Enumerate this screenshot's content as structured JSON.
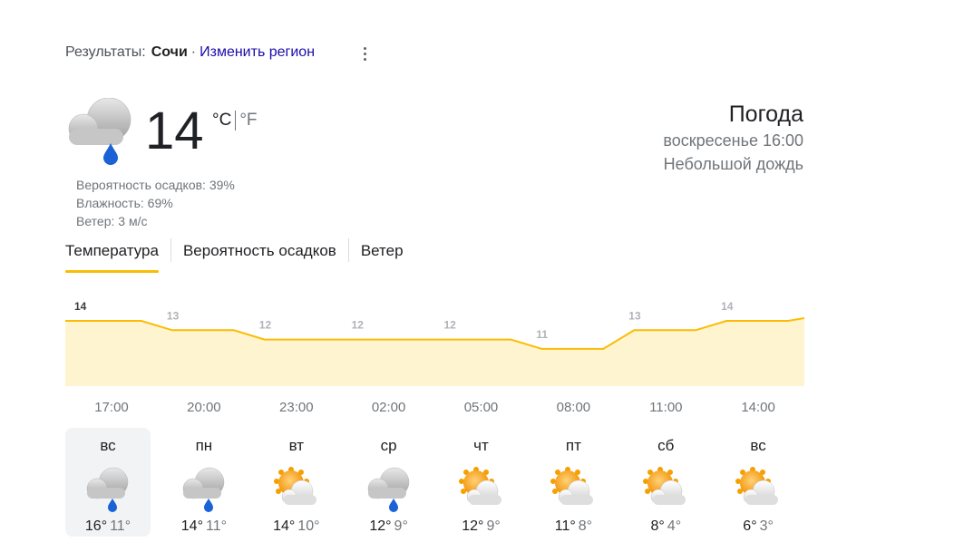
{
  "results": {
    "label": "Результаты:",
    "city": "Сочи",
    "separator": "·",
    "change_region": "Изменить регион"
  },
  "current": {
    "temperature": "14",
    "unit_c": "°C",
    "unit_f": "°F",
    "icon": "rain-cloud-icon",
    "precipitation": "Вероятность осадков: 39%",
    "humidity": "Влажность: 69%",
    "wind": "Ветер: 3 м/с"
  },
  "summary": {
    "title": "Погода",
    "datetime": "воскресенье 16:00",
    "condition": "Небольшой дождь"
  },
  "tabs": [
    {
      "label": "Температура",
      "active": true
    },
    {
      "label": "Вероятность осадков",
      "active": false
    },
    {
      "label": "Ветер",
      "active": false
    }
  ],
  "chart_data": {
    "type": "area",
    "x": [
      "17:00",
      "20:00",
      "23:00",
      "02:00",
      "05:00",
      "08:00",
      "11:00",
      "14:00"
    ],
    "values": [
      14,
      13,
      12,
      12,
      12,
      11,
      13,
      14
    ],
    "labels": [
      "14",
      "13",
      "12",
      "12",
      "12",
      "11",
      "13",
      "14"
    ],
    "ylim": [
      0,
      15
    ],
    "colors": {
      "line": "#fbbc04",
      "fill": "#fef5d0"
    }
  },
  "days": [
    {
      "name": "вс",
      "high": "16°",
      "low": "11°",
      "icon": "rain-cloud-icon",
      "selected": true
    },
    {
      "name": "пн",
      "high": "14°",
      "low": "11°",
      "icon": "rain-cloud-icon",
      "selected": false
    },
    {
      "name": "вт",
      "high": "14°",
      "low": "10°",
      "icon": "sun-behind-cloud-icon",
      "selected": false
    },
    {
      "name": "ср",
      "high": "12°",
      "low": "9°",
      "icon": "rain-cloud-icon",
      "selected": false
    },
    {
      "name": "чт",
      "high": "12°",
      "low": "9°",
      "icon": "sun-behind-cloud-icon",
      "selected": false
    },
    {
      "name": "пт",
      "high": "11°",
      "low": "8°",
      "icon": "sun-behind-cloud-icon",
      "selected": false
    },
    {
      "name": "сб",
      "high": "8°",
      "low": "4°",
      "icon": "sun-behind-cloud-icon",
      "selected": false
    },
    {
      "name": "вс",
      "high": "6°",
      "low": "3°",
      "icon": "sun-behind-cloud-icon",
      "selected": false
    }
  ]
}
